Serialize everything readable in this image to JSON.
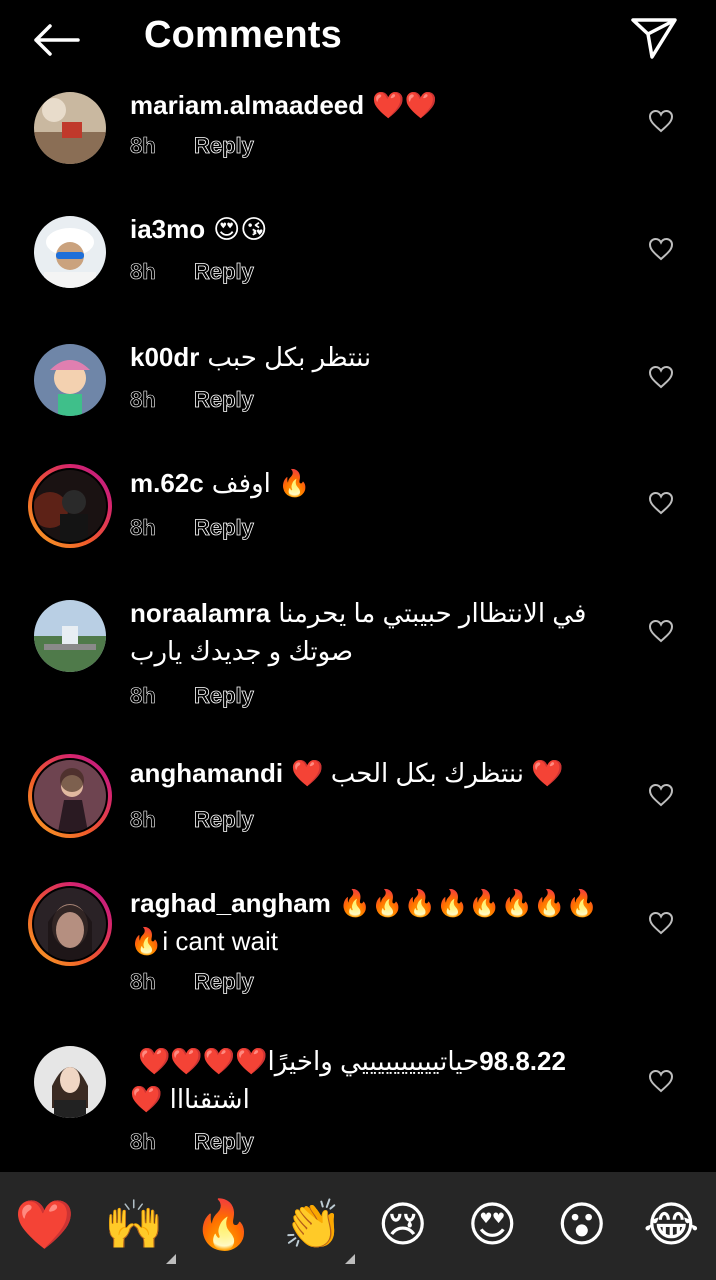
{
  "header": {
    "title": "Comments"
  },
  "comments": [
    {
      "username": "mariam.almaadeed",
      "text": "❤️❤️",
      "time": "8h",
      "reply": "Reply"
    },
    {
      "username": "ia3mo",
      "text": "😍😘",
      "time": "8h",
      "reply": "Reply"
    },
    {
      "username": "k00dr",
      "text": "ننتظر بكل حبب",
      "time": "8h",
      "reply": "Reply"
    },
    {
      "username": "m.62c",
      "text": "اوفف 🔥",
      "time": "8h",
      "reply": "Reply"
    },
    {
      "username": "noraalamra",
      "text": "في الانتظاار حبيبتي ما يحرمنا",
      "text2": "صوتك و جديدك يارب",
      "time": "8h",
      "reply": "Reply"
    },
    {
      "username": "anghamandi",
      "text": "❤️ ننتظرك بكل الحب ❤️",
      "time": "8h",
      "reply": "Reply"
    },
    {
      "username": "raghad_angham",
      "text": "🔥🔥🔥🔥🔥🔥🔥🔥",
      "text2": "🔥i cant wait",
      "time": "8h",
      "reply": "Reply"
    },
    {
      "username": "98.8.22",
      "text": "حياتييييييييييي واخيرًا❤️❤️❤️❤️",
      "text2": "اشتقنااا ❤️",
      "time": "8h",
      "reply": "Reply"
    }
  ],
  "reactions": [
    "❤️",
    "🙌",
    "🔥",
    "👏",
    "😢",
    "😍",
    "😮",
    "😂"
  ],
  "colors": {
    "background": "#000000",
    "reaction_bar": "#262626",
    "story_ring_start": "#f9a825",
    "story_ring_end": "#b11a8a"
  }
}
